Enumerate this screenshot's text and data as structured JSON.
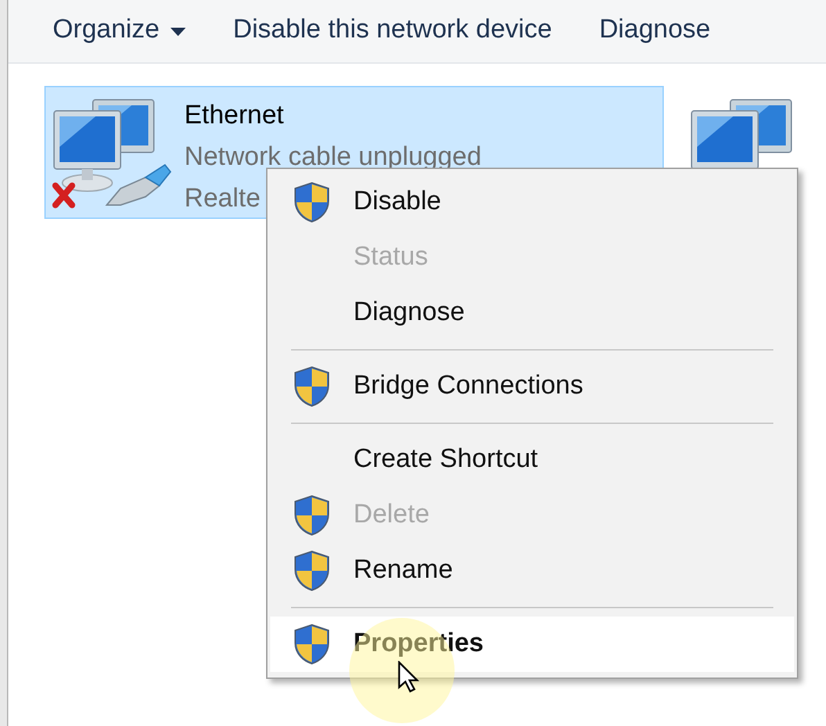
{
  "toolbar": {
    "items": [
      {
        "label": "Organize",
        "dropdown": true
      },
      {
        "label": "Disable this network device",
        "dropdown": false
      },
      {
        "label": "Diagnose",
        "dropdown": false
      }
    ]
  },
  "adapters": [
    {
      "name": "Ethernet",
      "status": "Network cable unplugged",
      "device": "Realte",
      "selected": true,
      "disconnected": true
    },
    {
      "selected": false,
      "disconnected": false
    }
  ],
  "context_menu": {
    "items": [
      {
        "kind": "item",
        "label": "Disable",
        "shield": true,
        "disabled": false,
        "default": false,
        "hovered": false
      },
      {
        "kind": "item",
        "label": "Status",
        "shield": false,
        "disabled": true,
        "default": false,
        "hovered": false
      },
      {
        "kind": "item",
        "label": "Diagnose",
        "shield": false,
        "disabled": false,
        "default": false,
        "hovered": false
      },
      {
        "kind": "separator"
      },
      {
        "kind": "item",
        "label": "Bridge Connections",
        "shield": true,
        "disabled": false,
        "default": false,
        "hovered": false
      },
      {
        "kind": "separator"
      },
      {
        "kind": "item",
        "label": "Create Shortcut",
        "shield": false,
        "disabled": false,
        "default": false,
        "hovered": false
      },
      {
        "kind": "item",
        "label": "Delete",
        "shield": true,
        "disabled": true,
        "default": false,
        "hovered": false
      },
      {
        "kind": "item",
        "label": "Rename",
        "shield": true,
        "disabled": false,
        "default": false,
        "hovered": false
      },
      {
        "kind": "separator"
      },
      {
        "kind": "item",
        "label": "Properties",
        "shield": true,
        "disabled": false,
        "default": true,
        "hovered": true
      }
    ]
  }
}
